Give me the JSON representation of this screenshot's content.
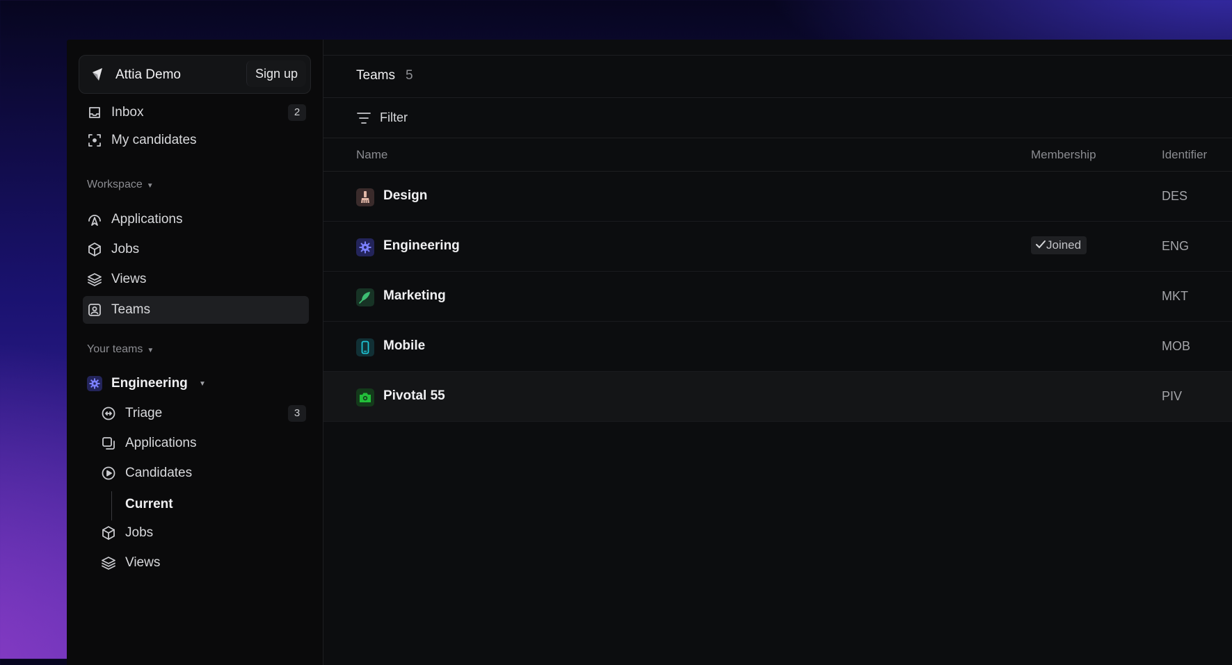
{
  "workspace": {
    "name": "Attia Demo",
    "signup_label": "Sign up"
  },
  "nav": {
    "inbox": {
      "label": "Inbox",
      "count": "2"
    },
    "my_candidates": {
      "label": "My candidates"
    }
  },
  "workspace_section": {
    "label": "Workspace",
    "items": [
      "Applications",
      "Jobs",
      "Views",
      "Teams"
    ],
    "active": "Teams"
  },
  "your_teams": {
    "label": "Your teams",
    "team": "Engineering",
    "items": {
      "triage": {
        "label": "Triage",
        "count": "3"
      },
      "applications": "Applications",
      "candidates": "Candidates",
      "current": "Current",
      "jobs": "Jobs",
      "views": "Views"
    }
  },
  "main": {
    "title": "Teams",
    "count": "5",
    "filter_label": "Filter",
    "columns": {
      "name": "Name",
      "membership": "Membership",
      "identifier": "Identifier"
    },
    "rows": [
      {
        "name": "Design",
        "membership": "",
        "identifier": "DES",
        "icon": "paintbrush-icon",
        "color": "#e2b8a8"
      },
      {
        "name": "Engineering",
        "membership": "Joined",
        "identifier": "ENG",
        "icon": "gear-icon",
        "color": "#5b5ff0"
      },
      {
        "name": "Marketing",
        "membership": "",
        "identifier": "MKT",
        "icon": "feather-icon",
        "color": "#3dbd72"
      },
      {
        "name": "Mobile",
        "membership": "",
        "identifier": "MOB",
        "icon": "phone-icon",
        "color": "#1ec6d6"
      },
      {
        "name": "Pivotal 55",
        "membership": "",
        "identifier": "PIV",
        "icon": "camera-icon",
        "color": "#22c03a"
      }
    ]
  },
  "colors": {
    "accent": "#5b5ff0",
    "background": "#0c0d0f"
  }
}
